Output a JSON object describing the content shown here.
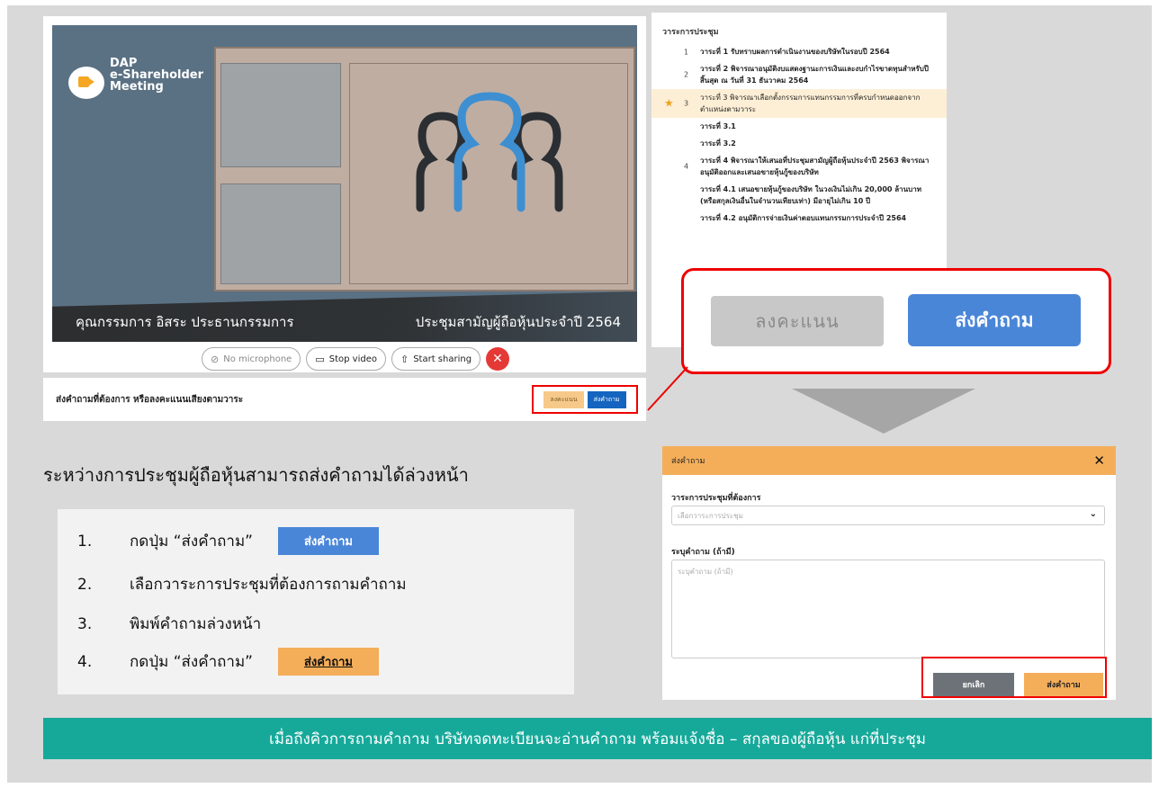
{
  "meeting": {
    "logo_text": "DAP\ne-Shareholder\nMeeting",
    "caption_left": "คุณกรรมการ อิสระ ประธานกรรมการ",
    "caption_right": "ประชุมสามัญผู้ถือหุ้นประจำปี 2564",
    "controls": {
      "mic": "No microphone",
      "video": "Stop video",
      "share": "Start sharing"
    },
    "strip_label": "ส่งคำถามที่ต้องการ หรือลงคะแนนเสียงตามวาระ",
    "strip_vote": "ลงคะแนน",
    "strip_ask": "ส่งคำถาม"
  },
  "agenda": {
    "title": "วาระการประชุม",
    "items": [
      {
        "num": "1",
        "text": "วาระที่ 1 รับทราบผลการดำเนินงานของบริษัทในรอบปี 2564"
      },
      {
        "num": "2",
        "text": "วาระที่ 2 พิจารณาอนุมัติงบแสดงฐานะการเงินและงบกำไรขาดทุนสำหรับปีสิ้นสุด ณ วันที่ 31 ธันวาคม 2564"
      },
      {
        "num": "3",
        "text": "วาระที่ 3 พิจารณาเลือกตั้งกรรมการแทนกรรมการที่ครบกำหนดออกจากตำแหน่งตามวาระ"
      },
      {
        "num": "",
        "text": "วาระที่ 3.1"
      },
      {
        "num": "",
        "text": "วาระที่ 3.2"
      },
      {
        "num": "4",
        "text": "วาระที่ 4 พิจารณาให้เสนอที่ประชุมสามัญผู้ถือหุ้นประจำปี 2563 พิจารณาอนุมัติออกและเสนอขายหุ้นกู้ของบริษัท"
      },
      {
        "num": "",
        "text": "วาระที่ 4.1 เสนอขายหุ้นกู้ของบริษัท ในวงเงินไม่เกิน 20,000 ล้านบาท (หรือสกุลเงินอื่นในจำนวนเทียบเท่า) มีอายุไม่เกิน 10 ปี"
      },
      {
        "num": "",
        "text": "วาระที่ 4.2 อนุมัติการจ่ายเงินค่าตอบแทนกรรมการประจำปี 2564"
      }
    ]
  },
  "zoom": {
    "vote": "ลงคะแนน",
    "ask": "ส่งคำถาม"
  },
  "instructions": {
    "heading": "ระหว่างการประชุมผู้ถือหุ้นสามารถส่งคำถามได้ล่วงหน้า",
    "steps": [
      {
        "num": "1.",
        "text": "กดปุ่ม “ส่งคำถาม”",
        "button": "ส่งคำถาม"
      },
      {
        "num": "2.",
        "text": "เลือกวาระการประชุมที่ต้องการถามคำถาม"
      },
      {
        "num": "3.",
        "text": "พิมพ์คำถามล่วงหน้า"
      },
      {
        "num": "4.",
        "text": "กดปุ่ม “ส่งคำถาม”",
        "button": "ส่งคำถาม"
      }
    ]
  },
  "modal": {
    "title": "ส่งคำถาม",
    "agenda_label": "วาระการประชุมที่ต้องการ",
    "agenda_placeholder": "เลือกวาระการประชุม",
    "question_label": "ระบุคำถาม (ถ้ามี)",
    "question_placeholder": "ระบุคำถาม (ถ้ามี)",
    "cancel": "ยกเลิก",
    "send": "ส่งคำถาม"
  },
  "banner": "เมื่อถึงคิวการถามคำถาม บริษัทจดทะเบียนจะอ่านคำถาม พร้อมแจ้งชื่อ – สกุลของผู้ถือหุ้น แก่ที่ประชุม",
  "colors": {
    "accent_blue": "#4a86d8",
    "accent_orange": "#f4ae5a",
    "banner_teal": "#16a99a",
    "highlight_red": "#e00000"
  }
}
